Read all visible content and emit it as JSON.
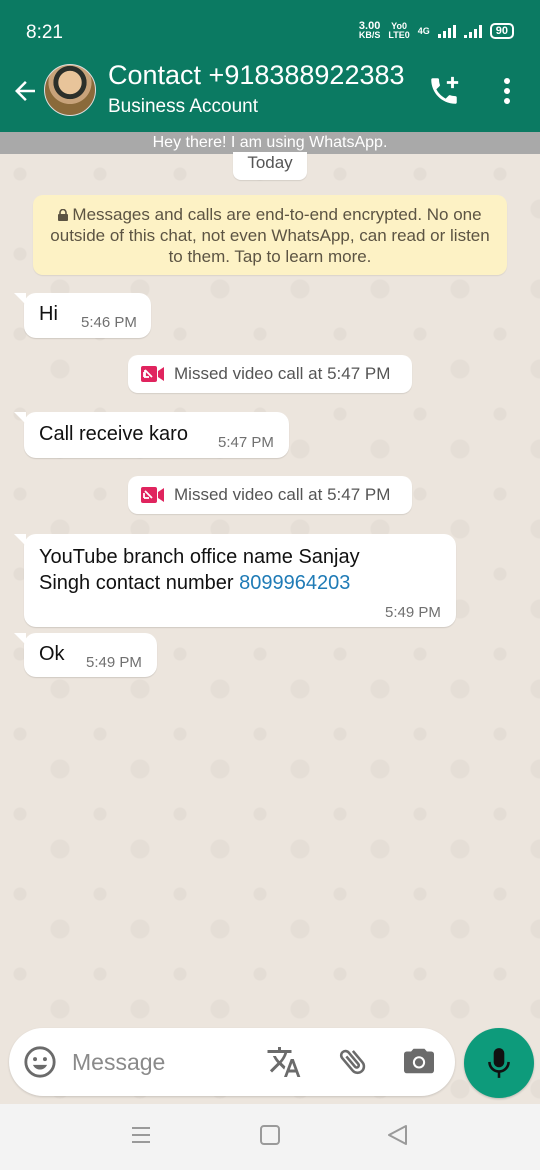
{
  "status_bar": {
    "time": "8:21",
    "net_speed": "3.00",
    "net_unit": "KB/S",
    "carrier_top": "Yo0",
    "carrier_bottom": "LTE0",
    "network": "4G",
    "battery": "90"
  },
  "header": {
    "contact_name": "Contact +918388922383",
    "subtitle": "Business Account",
    "about": "Hey there! I am using WhatsApp."
  },
  "chat": {
    "date_label": "Today",
    "encryption_notice": "Messages and calls are end-to-end encrypted. No one outside of this chat, not even WhatsApp, can read or listen to them. Tap to learn more.",
    "messages": [
      {
        "text": "Hi",
        "time": "5:46 PM"
      },
      {
        "system": "Missed video call at 5:47 PM"
      },
      {
        "text": "Call receive karo",
        "time": "5:47 PM"
      },
      {
        "system": "Missed video call at 5:47 PM"
      },
      {
        "text_line1": "YouTube branch office name Sanjay",
        "text_line2": "Singh contact number ",
        "link": "8099964203",
        "time": "5:49 PM"
      },
      {
        "text": "Ok",
        "time": "5:49 PM"
      }
    ]
  },
  "input": {
    "placeholder": "Message"
  },
  "colors": {
    "header": "#0b7a62",
    "accent": "#0d9b7b",
    "chat_bg": "#ece5dd",
    "encryption_bg": "#fdf2c5",
    "missed_call": "#e0245e",
    "link": "#1f7bb6"
  },
  "icons": {
    "back": "back-arrow-icon",
    "add_call": "phone-plus-icon",
    "menu": "more-vert-icon",
    "emoji": "emoji-icon",
    "translate": "translate-icon",
    "attach": "paperclip-icon",
    "camera": "camera-icon",
    "mic": "mic-icon",
    "missed_video": "missed-video-call-icon"
  }
}
